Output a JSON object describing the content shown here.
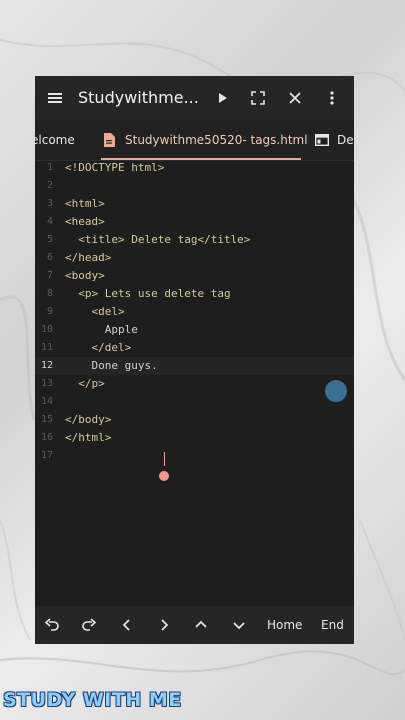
{
  "app": {
    "title": "Studywithme...",
    "accent_color": "#f3a88f"
  },
  "toolbar": {
    "icons": [
      "menu-icon",
      "play-icon",
      "fullscreen-icon",
      "close-icon",
      "more-vert-icon"
    ]
  },
  "tabs": [
    {
      "label": "elcome",
      "active": false
    },
    {
      "label": "Studywithme50520- tags.html",
      "active": true
    },
    {
      "label": "Del",
      "active": false
    }
  ],
  "editor": {
    "current_line": 12,
    "lines": [
      {
        "num": "1",
        "text": "<!DOCTYPE html>",
        "kind": "tag"
      },
      {
        "num": "2",
        "text": "",
        "kind": "tag"
      },
      {
        "num": "3",
        "text": "<html>",
        "kind": "tag"
      },
      {
        "num": "4",
        "text": "<head>",
        "kind": "tag"
      },
      {
        "num": "5",
        "text": "  <title> Delete tag</title>",
        "kind": "tag"
      },
      {
        "num": "6",
        "text": "</head>",
        "kind": "tag"
      },
      {
        "num": "7",
        "text": "<body>",
        "kind": "tag"
      },
      {
        "num": "8",
        "text": "  <p> Lets use delete tag",
        "kind": "tag"
      },
      {
        "num": "9",
        "text": "    <del>",
        "kind": "tag"
      },
      {
        "num": "10",
        "text": "      Apple",
        "kind": "text"
      },
      {
        "num": "11",
        "text": "    </del>",
        "kind": "tag"
      },
      {
        "num": "12",
        "text": "    Done guys.",
        "kind": "text"
      },
      {
        "num": "13",
        "text": "  </p>",
        "kind": "tag"
      },
      {
        "num": "14",
        "text": "",
        "kind": "tag"
      },
      {
        "num": "15",
        "text": "</body>",
        "kind": "tag"
      },
      {
        "num": "16",
        "text": "</html>",
        "kind": "tag"
      },
      {
        "num": "17",
        "text": "",
        "kind": "tag"
      }
    ]
  },
  "bottom_bar": {
    "icons": [
      "undo-icon",
      "redo-icon",
      "arrow-left-icon",
      "arrow-right-icon",
      "arrow-up-icon",
      "arrow-down-icon"
    ],
    "home_label": "Home",
    "end_label": "End"
  },
  "watermark": {
    "text": "STUDY WITH ME"
  }
}
